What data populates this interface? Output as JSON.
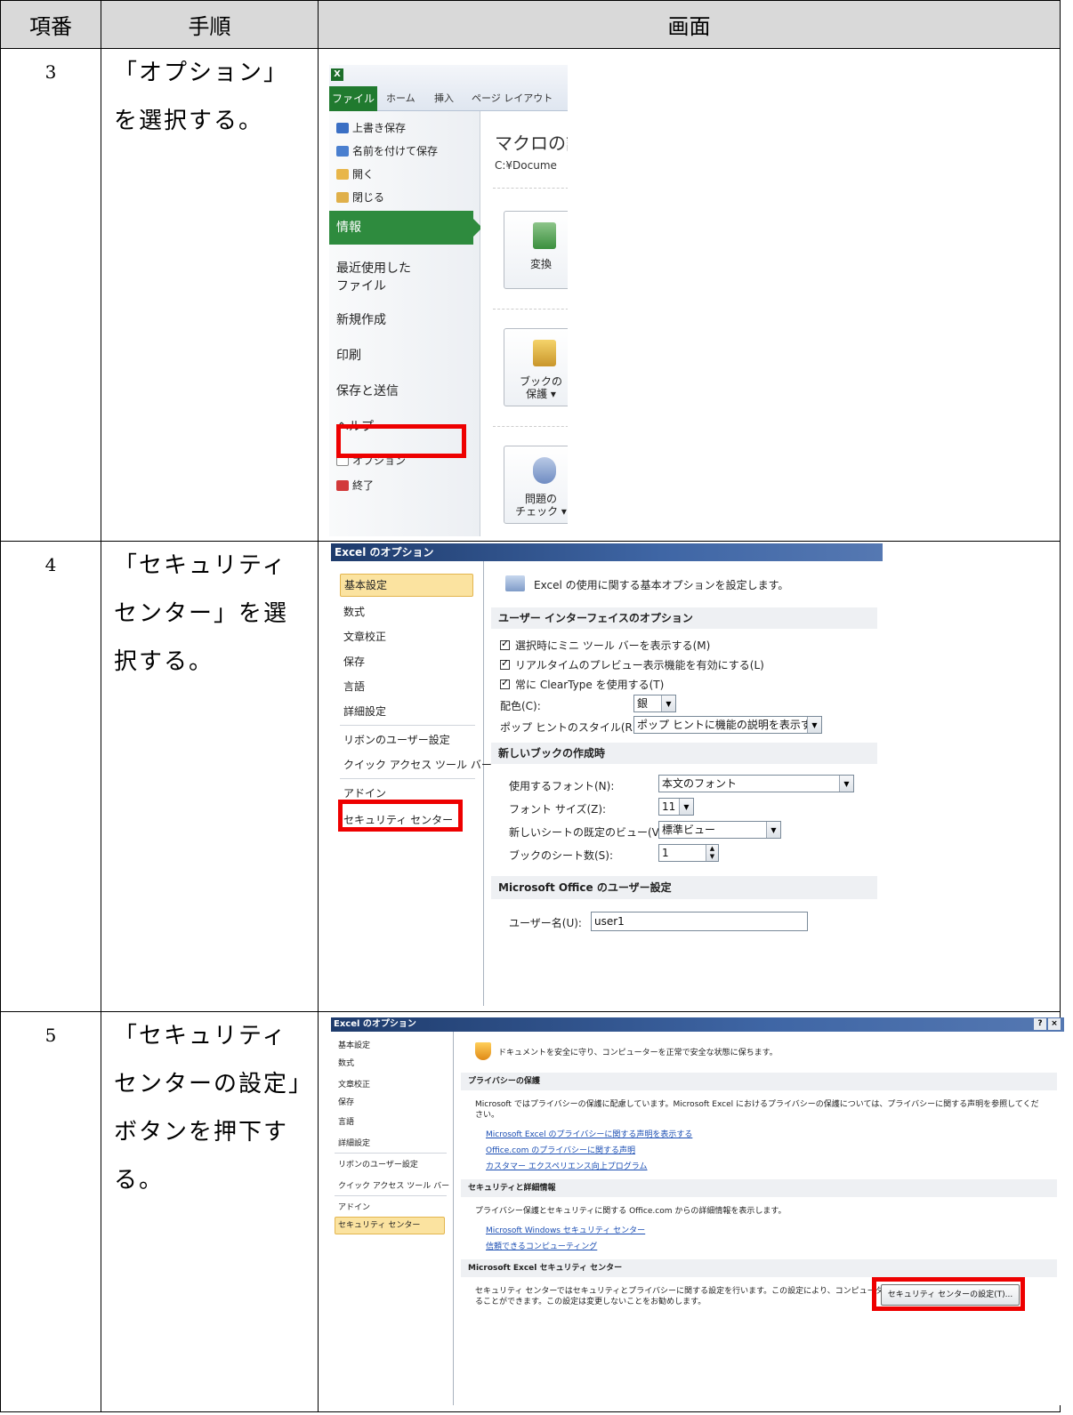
{
  "header": {
    "col_no": "項番",
    "col_step": "手順",
    "col_screen": "画面"
  },
  "rows": [
    {
      "no": "3",
      "step": "「オプション」を選択する。"
    },
    {
      "no": "4",
      "step": "「セキュリティセンター」を選択する。"
    },
    {
      "no": "5",
      "step": "「セキュリティセンターの設定」ボタンを押下する。"
    }
  ],
  "screen3": {
    "tabs": {
      "file": "ファイル",
      "home": "ホーム",
      "insert": "挿入",
      "pagelayout": "ページ レイアウト"
    },
    "menu": {
      "save": "上書き保存",
      "saveas": "名前を付けて保存",
      "open": "開く",
      "close": "閉じる",
      "info": "情報",
      "recent1": "最近使用した",
      "recent2": "ファイル",
      "new": "新規作成",
      "print": "印刷",
      "savesend": "保存と送信",
      "help": "ヘルプ",
      "options": "オプション",
      "exit": "終了"
    },
    "right": {
      "title": "マクロの設",
      "path": "C:¥Docume",
      "convert": "変換",
      "protect1": "ブックの",
      "protect2": "保護 ▾",
      "check1": "問題の",
      "check2": "チェック ▾"
    }
  },
  "screen4": {
    "title": "Excel のオプション",
    "nav": [
      "基本設定",
      "数式",
      "文章校正",
      "保存",
      "言語",
      "詳細設定",
      "リボンのユーザー設定",
      "クイック アクセス ツール バー",
      "アドイン",
      "セキュリティ センター"
    ],
    "header_text": "Excel の使用に関する基本オプションを設定します。",
    "section_ui": "ユーザー インターフェイスのオプション",
    "cb1": "選択時にミニ ツール バーを表示する(M)",
    "cb2": "リアルタイムのプレビュー表示機能を有効にする(L)",
    "cb3": "常に ClearType を使用する(T)",
    "color_label": "配色(C):",
    "color_value": "銀",
    "popup_label": "ポップ ヒントのスタイル(R):",
    "popup_value": "ポップ ヒントに機能の説明を表示する",
    "section_new": "新しいブックの作成時",
    "font_label": "使用するフォント(N):",
    "font_value": "本文のフォント",
    "size_label": "フォント サイズ(Z):",
    "size_value": "11",
    "view_label": "新しいシートの既定のビュー(V):",
    "view_value": "標準ビュー",
    "sheets_label": "ブックのシート数(S):",
    "sheets_value": "1",
    "section_office": "Microsoft Office のユーザー設定",
    "user_label": "ユーザー名(U):",
    "user_value": "user1"
  },
  "screen5": {
    "title": "Excel のオプション",
    "help_btn": "?",
    "close_btn": "×",
    "nav": [
      "基本設定",
      "数式",
      "文章校正",
      "保存",
      "言語",
      "詳細設定",
      "リボンのユーザー設定",
      "クイック アクセス ツール バー",
      "アドイン",
      "セキュリティ センター"
    ],
    "header_text": "ドキュメントを安全に守り、コンピューターを正常で安全な状態に保ちます。",
    "section_privacy": "プライバシーの保護",
    "privacy_text1": "Microsoft ではプライバシーの保護に配慮しています。Microsoft Excel におけるプライバシーの保護については、プライバシーに関する声明を参照してくだ",
    "privacy_text2": "さい。",
    "link1": "Microsoft Excel のプライバシーに関する声明を表示する",
    "link2": "Office.com のプライバシーに関する声明",
    "link3": "カスタマー エクスペリエンス向上プログラム",
    "section_security": "セキュリティと詳細情報",
    "security_text": "プライバシー保護とセキュリティに関する Office.com からの詳細情報を表示します。",
    "link4": "Microsoft Windows セキュリティ センター",
    "link5": "信頼できるコンピューティング",
    "section_trust": "Microsoft Excel セキュリティ センター",
    "trust_text1": "セキュリティ センターではセキュリティとプライバシーに関する設定を行います。この設定により、コンピューターを保護す",
    "trust_text2": "ることができます。この設定は変更しないことをお勧めします。",
    "trust_button": "セキュリティ センターの設定(T)..."
  },
  "colors": {
    "highlight": "#ee0000",
    "header_bg": "#d9d9d9",
    "excel_green": "#207a2f"
  }
}
